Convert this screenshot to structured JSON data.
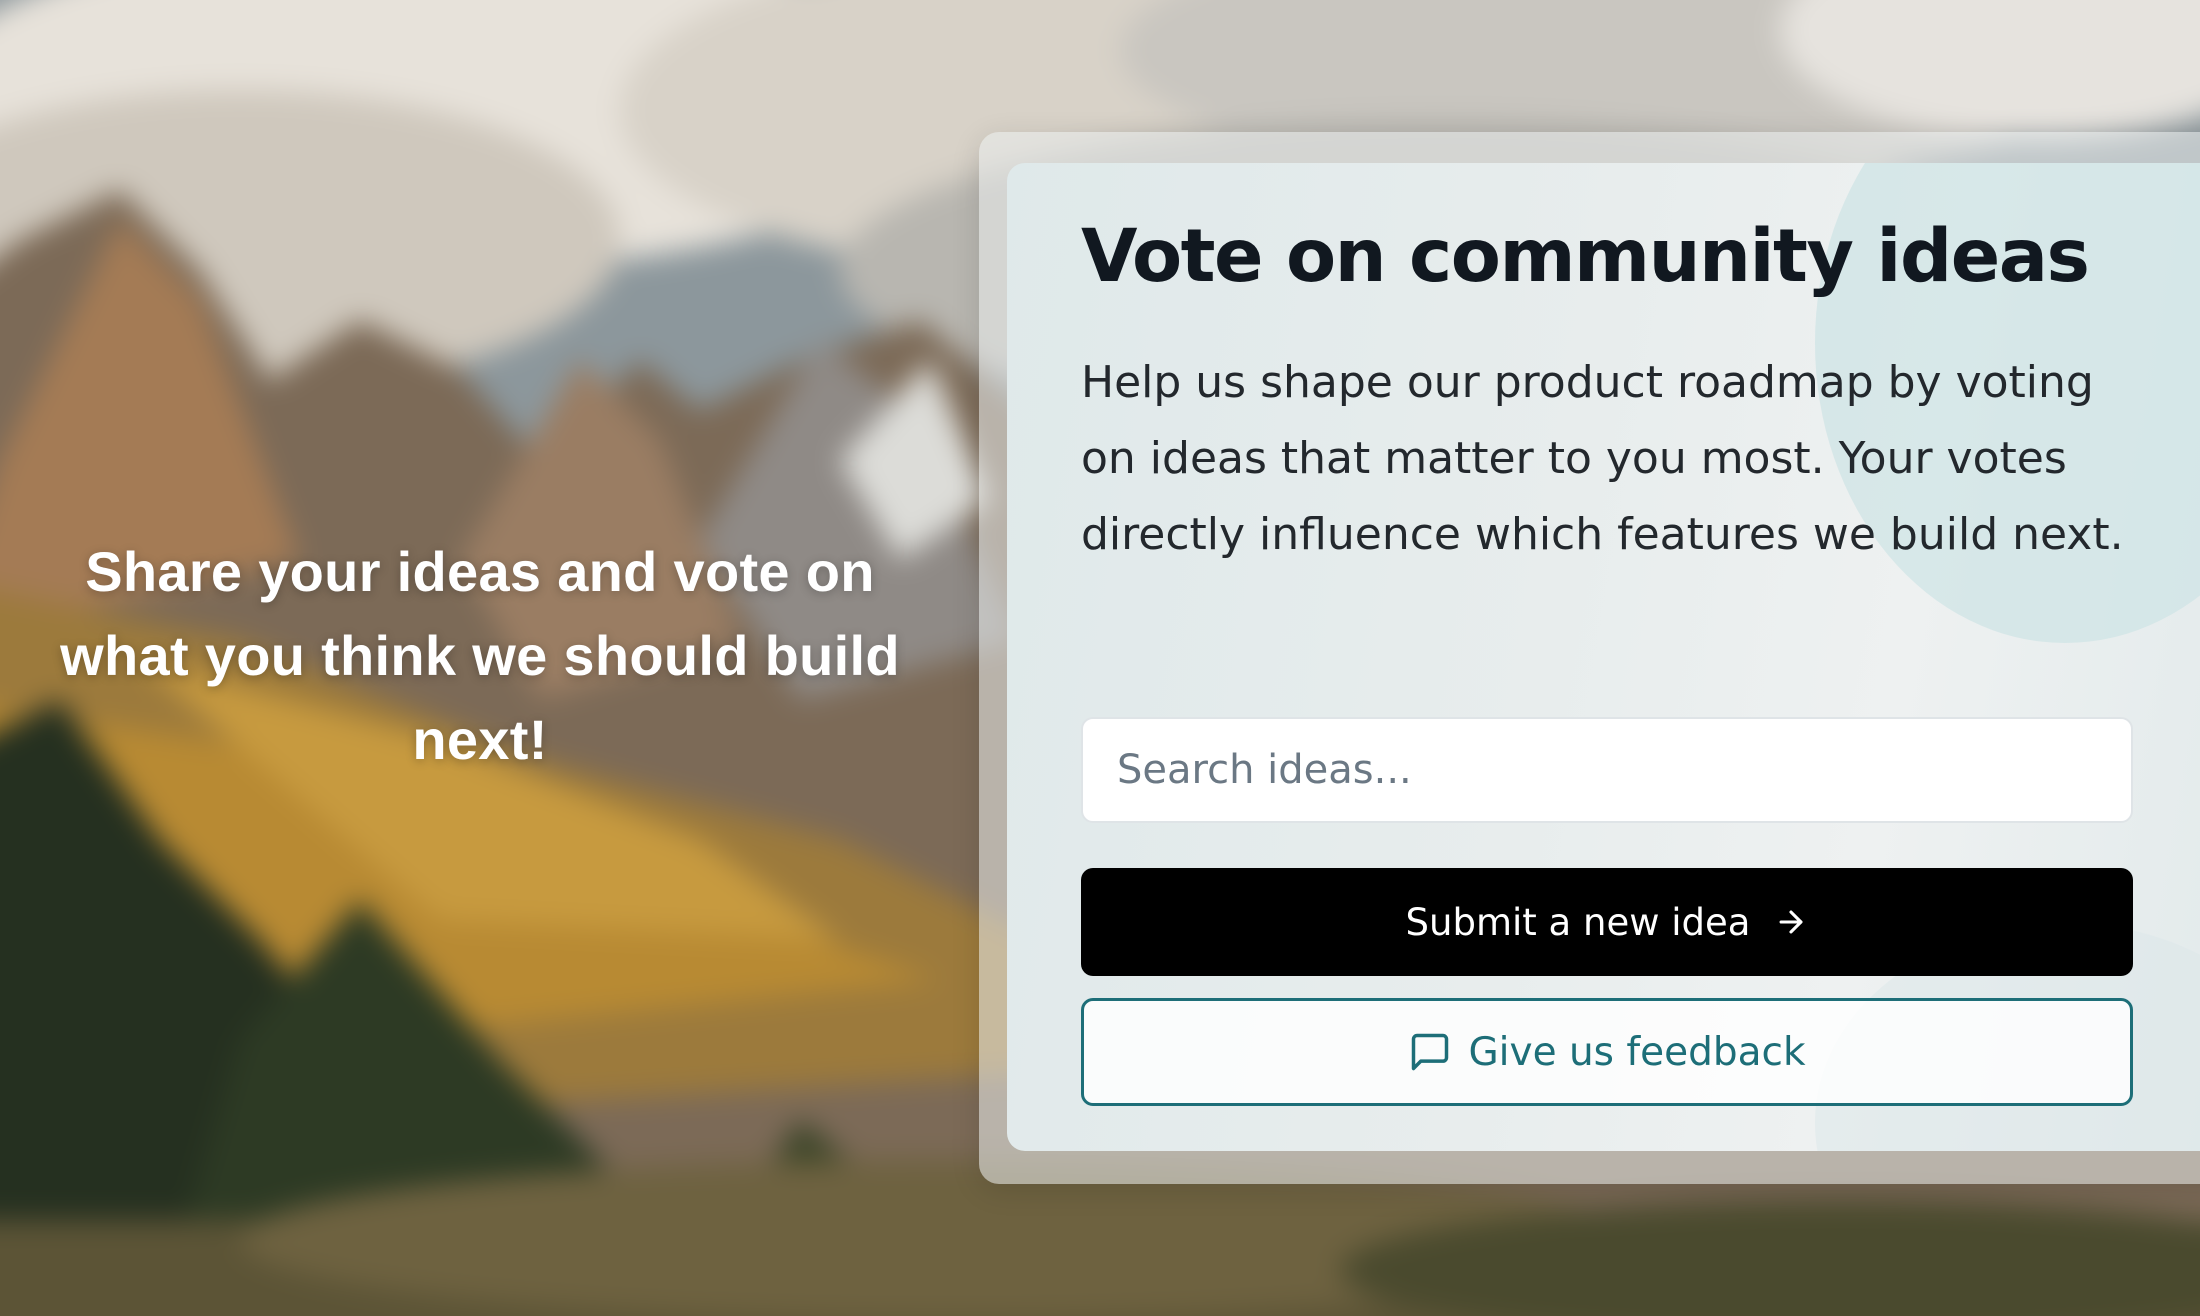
{
  "hero": {
    "tagline": "Share your ideas and vote on what you think we should build next!"
  },
  "card": {
    "title": "Vote on community ideas",
    "description": "Help us shape our product roadmap by voting on ideas that matter to you most. Your votes directly influence which features we build next.",
    "search": {
      "placeholder": "Search ideas...",
      "value": ""
    },
    "submit_button": {
      "label": "Submit a new idea",
      "icon": "arrow-right-icon"
    },
    "feedback_button": {
      "label": "Give us feedback",
      "icon": "message-square-icon"
    }
  },
  "colors": {
    "primary_button_bg": "#000000",
    "accent_teal": "#1d6e78",
    "title_text": "#111820"
  }
}
